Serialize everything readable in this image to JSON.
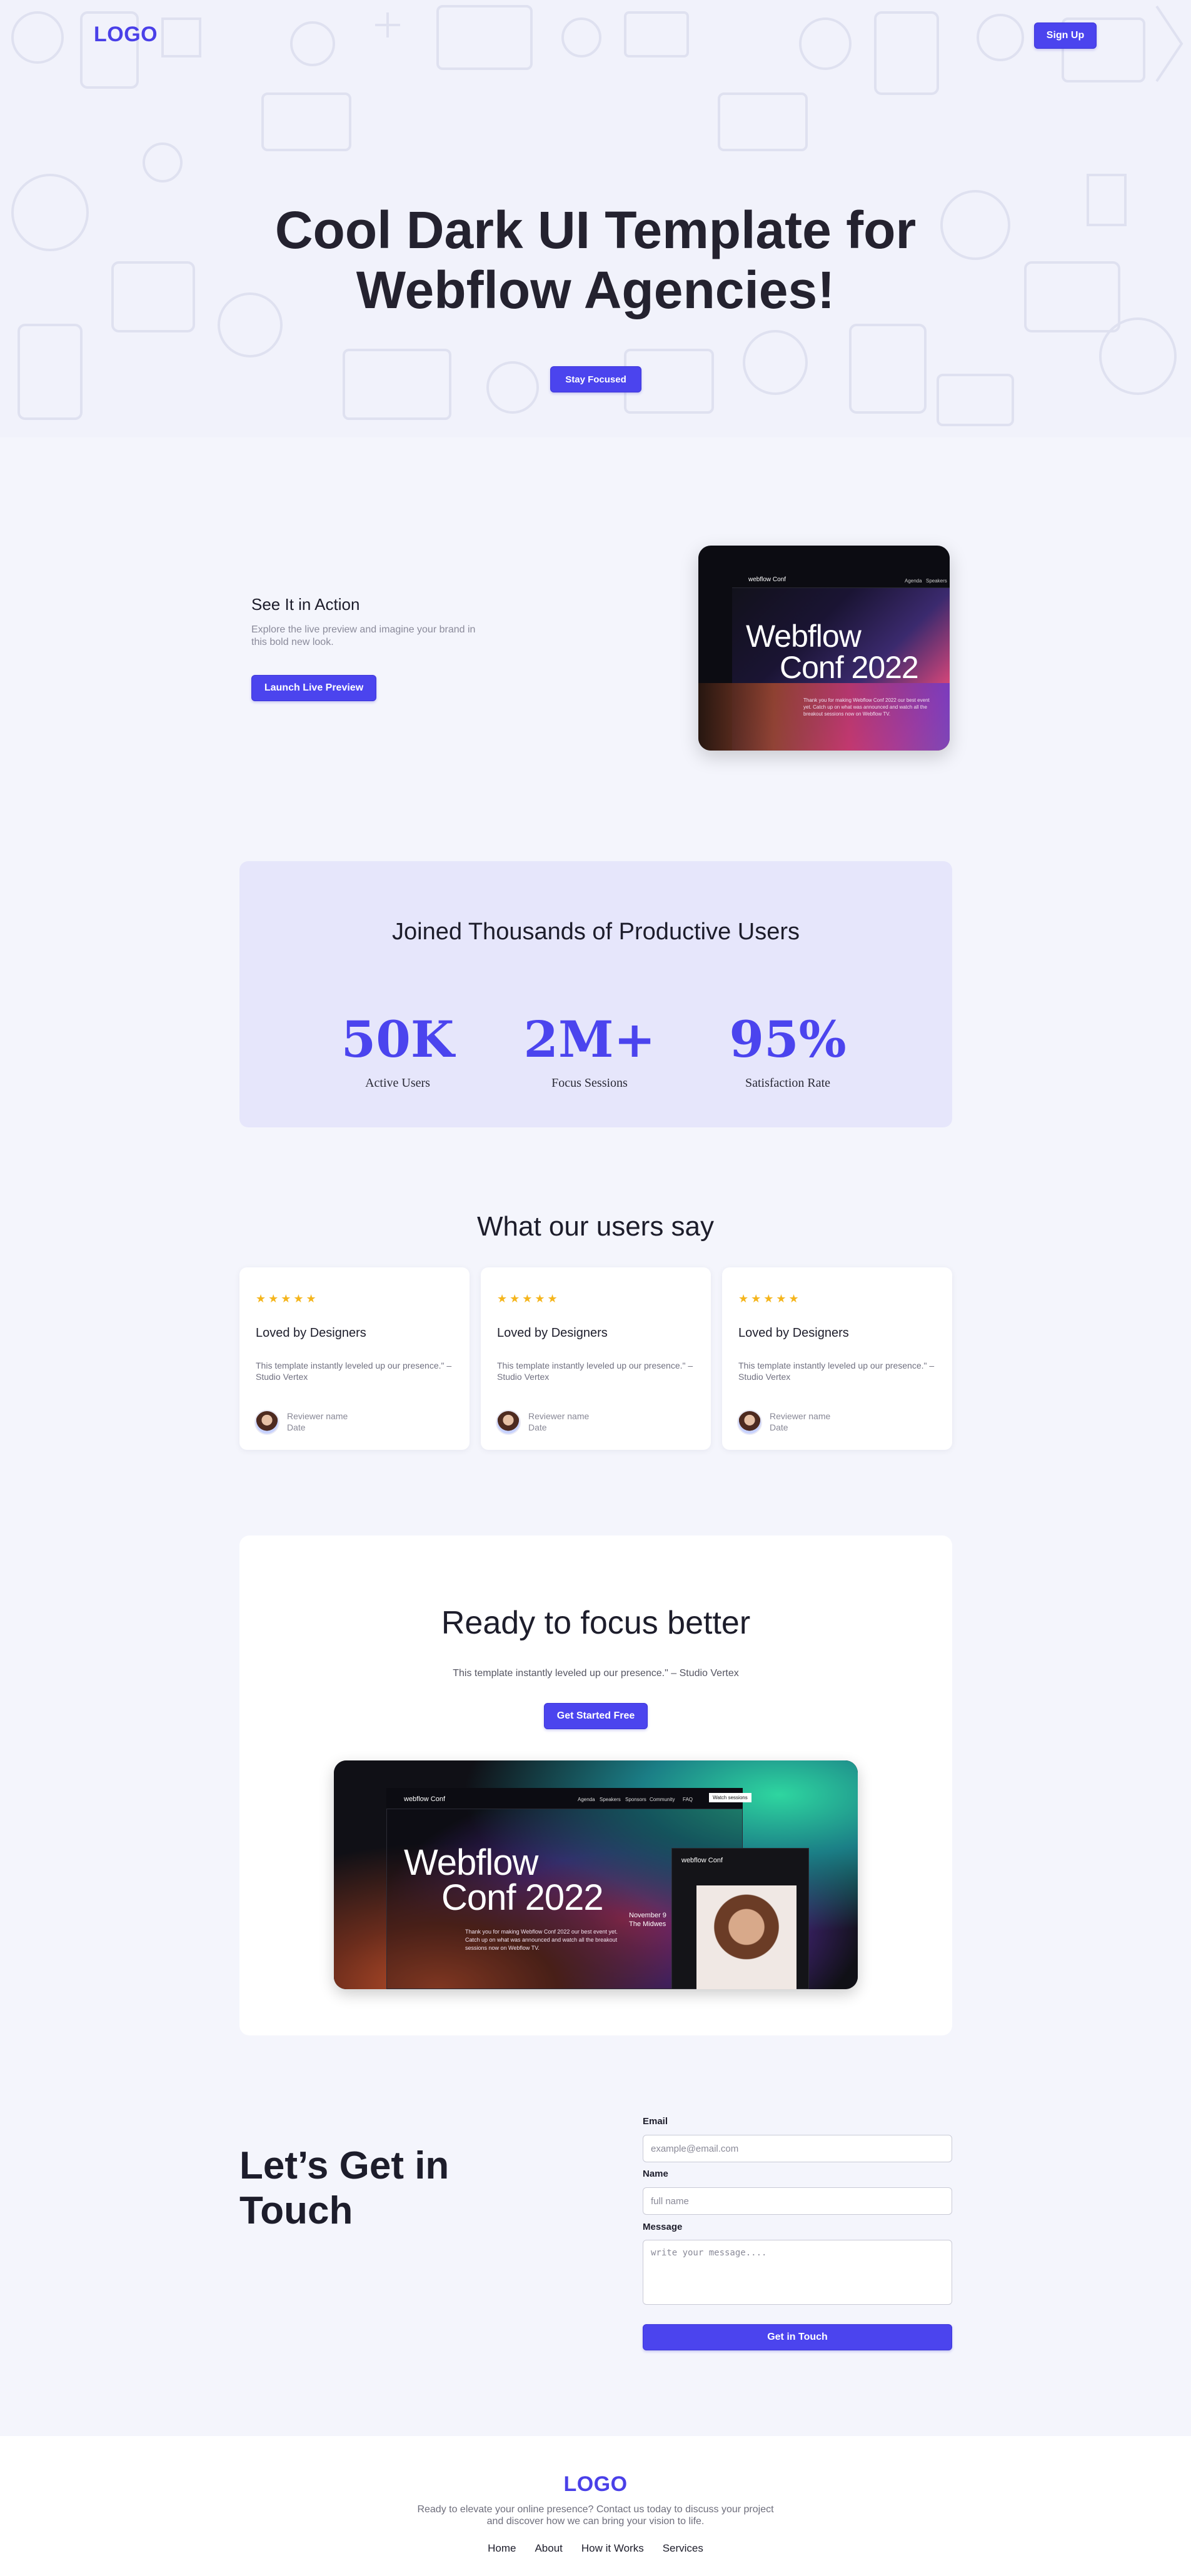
{
  "header": {
    "logo": "LOGO",
    "signup_label": "Sign Up"
  },
  "hero": {
    "title": "Cool Dark UI Template for Webflow Agencies!",
    "cta_label": "Stay Focused"
  },
  "preview": {
    "title": "See It in Action",
    "description": "Explore the live preview and imagine your brand in this bold new look.",
    "cta_label": "Launch Live Preview",
    "image": {
      "brand": "webflow Conf",
      "headline_line1": "Webflow",
      "headline_line2": "Conf 2022",
      "nav": [
        "Agenda",
        "Speakers"
      ],
      "caption": "Thank you for making Webflow Conf 2022 our best event yet. Catch up on what was announced and watch all the breakout sessions now on Webflow TV."
    }
  },
  "stats": {
    "title": "Joined Thousands of Productive Users",
    "items": [
      {
        "value": "50K",
        "label": "Active Users"
      },
      {
        "value": "2M+",
        "label": "Focus Sessions"
      },
      {
        "value": "95%",
        "label": "Satisfaction Rate"
      }
    ]
  },
  "testimonials": {
    "heading": "What our users say",
    "items": [
      {
        "stars": "★★★★★",
        "title": "Loved by Designers",
        "quote": "This template instantly leveled up our presence.\" – Studio Vertex",
        "reviewer": "Reviewer name",
        "date": "Date"
      },
      {
        "stars": "★★★★★",
        "title": "Loved by Designers",
        "quote": "This template instantly leveled up our presence.\" – Studio Vertex",
        "reviewer": "Reviewer name",
        "date": "Date"
      },
      {
        "stars": "★★★★★",
        "title": "Loved by Designers",
        "quote": "This template instantly leveled up our presence.\" – Studio Vertex",
        "reviewer": "Reviewer name",
        "date": "Date"
      }
    ]
  },
  "ready": {
    "title": "Ready to focus better",
    "subtitle": "This template instantly leveled up our presence.\" – Studio Vertex",
    "cta_label": "Get Started Free",
    "image": {
      "brand": "webflow Conf",
      "headline_line1": "Webflow",
      "headline_line2": "Conf 2022",
      "nav": [
        "Agenda",
        "Speakers",
        "Sponsors",
        "Community",
        "FAQ"
      ],
      "watch_label": "Watch sessions",
      "event_line1": "November 9",
      "event_line2": "The Midwes",
      "caption": "Thank you for making Webflow Conf 2022 our best event yet. Catch up on what was announced and watch all the breakout sessions now on Webflow TV."
    }
  },
  "contact": {
    "title_line1": "Let’s Get in",
    "title_line2": "Touch",
    "email_label": "Email",
    "email_placeholder": "example@email.com",
    "name_label": "Name",
    "name_placeholder": "full name",
    "message_label": "Message",
    "message_placeholder": "write your message....",
    "submit_label": "Get in Touch"
  },
  "footer": {
    "logo": "LOGO",
    "description_line1": "Ready to elevate your online presence? Contact us today to discuss your project",
    "description_line2": "and discover how we can bring your vision to life.",
    "links": [
      "Home",
      "About",
      "How it Works",
      "Services"
    ]
  },
  "colors": {
    "accent": "#4b44ee",
    "stats_bg": "#e6e6fb",
    "page_bg": "#f4f5fc",
    "star": "#f5b51c"
  }
}
